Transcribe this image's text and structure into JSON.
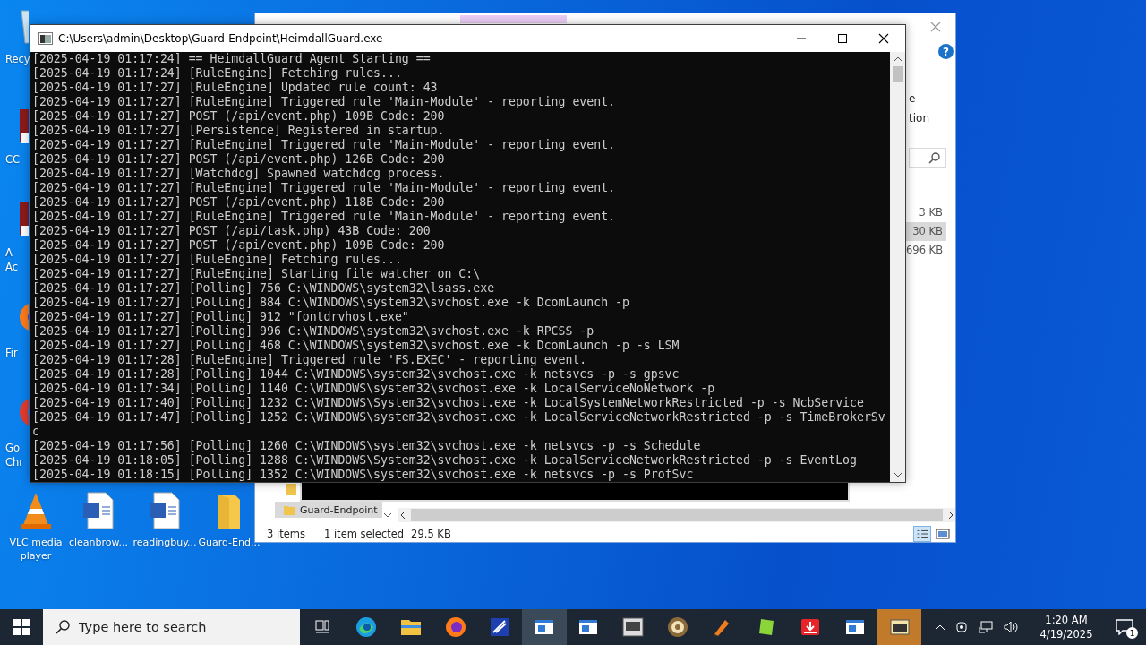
{
  "desktop_icons": [
    {
      "kind": "recycle-bin",
      "lines": [
        "Recy"
      ]
    },
    {
      "kind": "shortcut",
      "lines": [
        "CC"
      ]
    },
    {
      "kind": "shortcut",
      "lines": [
        "A",
        "Ac"
      ]
    },
    {
      "kind": "browser",
      "lines": [
        "Fir"
      ]
    },
    {
      "kind": "browser",
      "lines": [
        "Go",
        "Chr"
      ]
    }
  ],
  "bottom_icons": [
    {
      "kind": "cone",
      "lines": [
        "VLC media",
        "player"
      ]
    },
    {
      "kind": "document",
      "lines": [
        "cleanbrow..."
      ]
    },
    {
      "kind": "document",
      "lines": [
        "readingbuy..."
      ]
    },
    {
      "kind": "folder",
      "lines": [
        "Guard-End..."
      ]
    }
  ],
  "explorer": {
    "help_button": "?",
    "ribbon_fragment": [
      "e",
      "tion"
    ],
    "sizes": [
      {
        "text": "3 KB",
        "selected": false
      },
      {
        "text": "30 KB",
        "selected": true
      },
      {
        "text": "696 KB",
        "selected": false
      }
    ],
    "folder_item": {
      "name": "Guard-Endpoint",
      "selected": true
    },
    "status": {
      "count": "3 items",
      "selection": "1 item selected",
      "size": "29.5 KB"
    }
  },
  "console": {
    "title": "C:\\Users\\admin\\Desktop\\Guard-Endpoint\\HeimdallGuard.exe",
    "lines": [
      "[2025-04-19 01:17:24] == HeimdallGuard Agent Starting ==",
      "[2025-04-19 01:17:24] [RuleEngine] Fetching rules...",
      "[2025-04-19 01:17:27] [RuleEngine] Updated rule count: 43",
      "[2025-04-19 01:17:27] [RuleEngine] Triggered rule 'Main-Module' - reporting event.",
      "[2025-04-19 01:17:27] POST (/api/event.php) 109B Code: 200",
      "[2025-04-19 01:17:27] [Persistence] Registered in startup.",
      "[2025-04-19 01:17:27] [RuleEngine] Triggered rule 'Main-Module' - reporting event.",
      "[2025-04-19 01:17:27] POST (/api/event.php) 126B Code: 200",
      "[2025-04-19 01:17:27] [Watchdog] Spawned watchdog process.",
      "[2025-04-19 01:17:27] [RuleEngine] Triggered rule 'Main-Module' - reporting event.",
      "[2025-04-19 01:17:27] POST (/api/event.php) 118B Code: 200",
      "[2025-04-19 01:17:27] [RuleEngine] Triggered rule 'Main-Module' - reporting event.",
      "[2025-04-19 01:17:27] POST (/api/task.php) 43B Code: 200",
      "[2025-04-19 01:17:27] POST (/api/event.php) 109B Code: 200",
      "[2025-04-19 01:17:27] [RuleEngine] Fetching rules...",
      "[2025-04-19 01:17:27] [RuleEngine] Starting file watcher on C:\\",
      "[2025-04-19 01:17:27] [Polling] 756 C:\\WINDOWS\\system32\\lsass.exe",
      "[2025-04-19 01:17:27] [Polling] 884 C:\\WINDOWS\\system32\\svchost.exe -k DcomLaunch -p",
      "[2025-04-19 01:17:27] [Polling] 912 \"fontdrvhost.exe\"",
      "[2025-04-19 01:17:27] [Polling] 996 C:\\WINDOWS\\system32\\svchost.exe -k RPCSS -p",
      "[2025-04-19 01:17:27] [Polling] 468 C:\\WINDOWS\\system32\\svchost.exe -k DcomLaunch -p -s LSM",
      "[2025-04-19 01:17:28] [RuleEngine] Triggered rule 'FS.EXEC' - reporting event.",
      "[2025-04-19 01:17:28] [Polling] 1044 C:\\WINDOWS\\system32\\svchost.exe -k netsvcs -p -s gpsvc",
      "[2025-04-19 01:17:34] [Polling] 1140 C:\\WINDOWS\\system32\\svchost.exe -k LocalServiceNoNetwork -p",
      "[2025-04-19 01:17:40] [Polling] 1232 C:\\WINDOWS\\System32\\svchost.exe -k LocalSystemNetworkRestricted -p -s NcbService",
      "[2025-04-19 01:17:47] [Polling] 1252 C:\\WINDOWS\\system32\\svchost.exe -k LocalServiceNetworkRestricted -p -s TimeBrokerSv",
      "c",
      "[2025-04-19 01:17:56] [Polling] 1260 C:\\WINDOWS\\system32\\svchost.exe -k netsvcs -p -s Schedule",
      "[2025-04-19 01:18:05] [Polling] 1288 C:\\WINDOWS\\System32\\svchost.exe -k LocalServiceNetworkRestricted -p -s EventLog",
      "[2025-04-19 01:18:15] [Polling] 1352 C:\\WINDOWS\\system32\\svchost.exe -k netsvcs -p -s ProfSvc"
    ]
  },
  "taskbar": {
    "search_placeholder": "Type here to search",
    "apps": [
      {
        "kind": "task-view",
        "selected": false
      },
      {
        "kind": "edge",
        "selected": false
      },
      {
        "kind": "explorer",
        "selected": false
      },
      {
        "kind": "firefox",
        "selected": false
      },
      {
        "kind": "tool",
        "selected": false
      },
      {
        "kind": "window",
        "selected": true
      },
      {
        "kind": "window",
        "selected": false
      },
      {
        "kind": "editor",
        "selected": false
      },
      {
        "kind": "disc",
        "selected": false
      },
      {
        "kind": "pen",
        "selected": false
      },
      {
        "kind": "note",
        "selected": false
      },
      {
        "kind": "download",
        "selected": false
      },
      {
        "kind": "window",
        "selected": false
      },
      {
        "kind": "console",
        "selected": true
      }
    ],
    "time": "1:20 AM",
    "date": "4/19/2025",
    "notifications": "1"
  }
}
